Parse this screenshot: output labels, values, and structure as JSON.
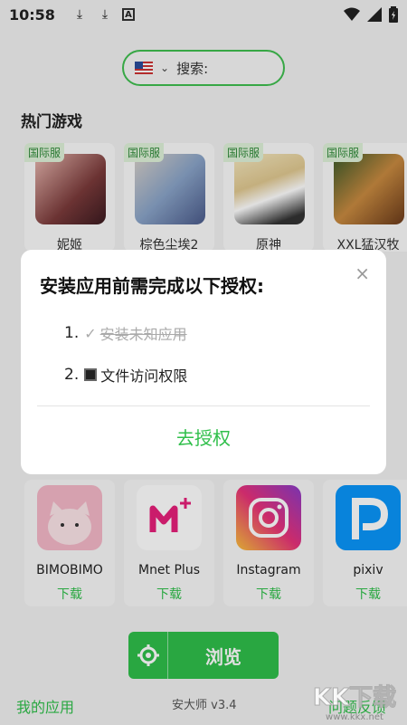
{
  "status_bar": {
    "time": "10:58",
    "a_icon": "A"
  },
  "search": {
    "placeholder": "搜索:"
  },
  "hot_section": {
    "title": "热门游戏"
  },
  "hot_games": [
    {
      "badge": "国际服",
      "name": "妮姬"
    },
    {
      "badge": "国际服",
      "name": "棕色尘埃2"
    },
    {
      "badge": "国际服",
      "name": "原神"
    },
    {
      "badge": "国际服",
      "name": "XXL猛汉牧"
    }
  ],
  "dialog": {
    "title": "安装应用前需完成以下授权:",
    "item1_num": "1.",
    "item1_text": "安装未知应用",
    "item2_num": "2.",
    "item2_text": "文件访问权限",
    "action": "去授权",
    "close": "×"
  },
  "apps": [
    {
      "name": "BIMOBIMO",
      "download": "下载"
    },
    {
      "name": "Mnet Plus",
      "download": "下载"
    },
    {
      "name": "Instagram",
      "download": "下载"
    },
    {
      "name": "pixiv",
      "download": "下载"
    }
  ],
  "footer": {
    "browse_label": "浏览",
    "my_apps": "我的应用",
    "version": "安大师 v3.4",
    "feedback": "问题反馈"
  },
  "watermark": {
    "text": "KK下载",
    "url": "www.kkx.net"
  }
}
